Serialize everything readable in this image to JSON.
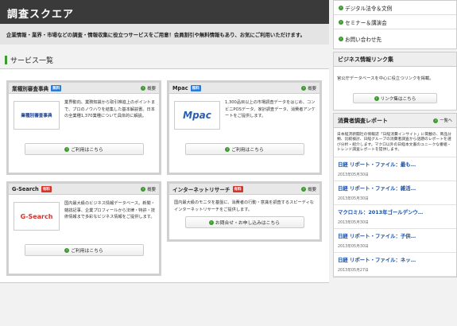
{
  "header": {
    "title": "調査スクエア"
  },
  "intro": {
    "text": "企業情報・業界・市場などの調査・情報収集に役立つサービスをご用意！会員割引や無料情報もあり、お気にご利用いただけます。"
  },
  "services": {
    "heading": "サービス一覧",
    "cards": [
      {
        "name": "業種別審査事典",
        "tag": "無料",
        "overview": "概要",
        "logo_text": "業種別審査事典",
        "description": "業界動向、業務知識から取引推進上のポイントまで、プロのノウハウを結集した基本解説書。日本の全業種1,370業種について具体的に解説。",
        "button": "ご利用はこちら"
      },
      {
        "name": "Mpac",
        "tag": "無料",
        "overview": "概要",
        "logo_text": "Mpac",
        "description": "1,300品目以上の市場調査データをはじめ、コンビニPOSデータ、家計調査データ、消費者アンケートをご提供します。",
        "button": "ご利用はこちら"
      },
      {
        "name": "G-Search",
        "tag": "有料",
        "overview": "概要",
        "logo_text": "G-Search",
        "description": "国内最大級のビジネス情報データベース。新聞・雑誌記事、企業プロフィールから法律・特許・技術情報まで多彩なビジネス情報をご提供します。",
        "button": "ご利用はこちら"
      },
      {
        "name": "インターネットリサーチ",
        "tag": "有料",
        "overview": "概要",
        "description": "国内最大級のモニタを基盤に、消費者の行動・意識を調査するスピーディなインターネットリサーチをご提供します。",
        "button": "お問合せ・お申し込みはこちら"
      }
    ]
  },
  "sidebar": {
    "nav": [
      "デジタル法令＆文例",
      "セミナー＆講演会",
      "お問い合わせ先"
    ],
    "biz_links": {
      "title": "ビジネス情報リンク集",
      "text": "官公庁データベースを中心に役立つリンクを掲載。",
      "button": "リンク集はこちら"
    },
    "reports": {
      "title": "消費者調査レポート",
      "more": "一覧へ",
      "description": "日本経済新聞社の情報誌「日経消費インサイト」に掲載の、商品分類、比較検討、日経グループの消費者調査から話題のレポートを選び分析・紹介します。マクロ以外の日経本文書のユニークな番組・トレンド調査レポートを提供します。",
      "items": [
        {
          "title": "日経 リポート・ファイル：最も…",
          "date": "2013年05月30日"
        },
        {
          "title": "日経 リポート・ファイル：雑活…",
          "date": "2013年05月30日"
        },
        {
          "title": "マクロミル：2013年ゴールデンウ…",
          "date": "2013年05月30日"
        },
        {
          "title": "日経 リポート・ファイル：子供…",
          "date": "2013年05月30日"
        },
        {
          "title": "日経 リポート・ファイル：ネッ…",
          "date": "2013年05月27日"
        }
      ]
    }
  }
}
